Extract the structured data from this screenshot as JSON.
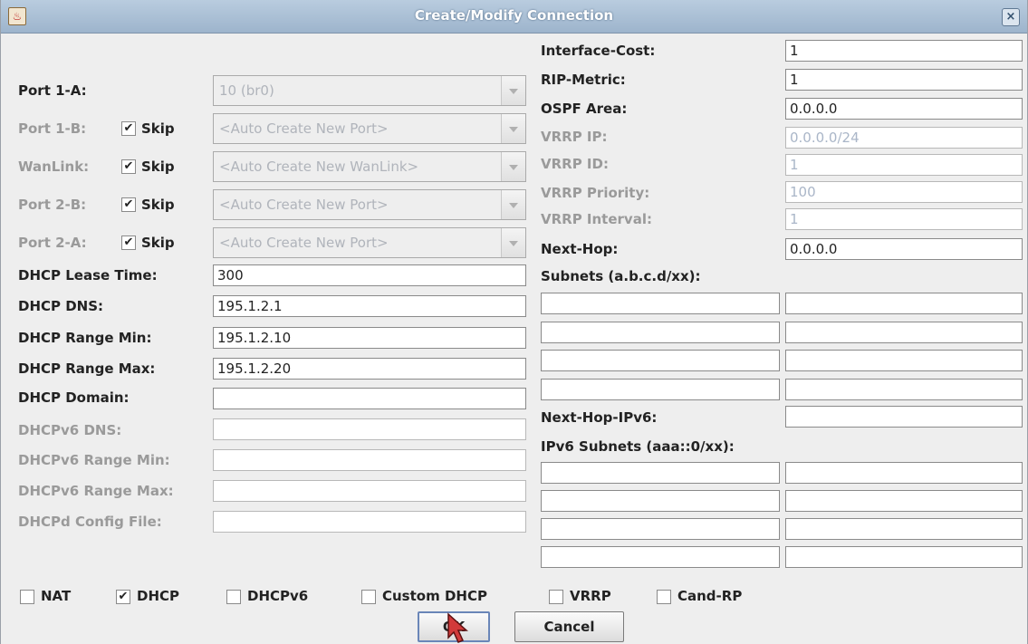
{
  "window": {
    "title": "Create/Modify Connection",
    "close_label": "×",
    "icon_label": "♨"
  },
  "left": {
    "port_1a": {
      "label": "Port 1-A:",
      "value": "10 (br0)"
    },
    "port_1b": {
      "label": "Port 1-B:",
      "skip_label": "Skip",
      "skip_mark": "✔",
      "value": "<Auto Create New Port>"
    },
    "wanlink": {
      "label": "WanLink:",
      "skip_label": "Skip",
      "skip_mark": "✔",
      "value": "<Auto Create New WanLink>"
    },
    "port_2b": {
      "label": "Port 2-B:",
      "skip_label": "Skip",
      "skip_mark": "✔",
      "value": "<Auto Create New Port>"
    },
    "port_2a": {
      "label": "Port 2-A:",
      "skip_label": "Skip",
      "skip_mark": "✔",
      "value": "<Auto Create New Port>"
    },
    "fields": [
      {
        "label": "DHCP Lease Time:",
        "value": "300"
      },
      {
        "label": "DHCP DNS:",
        "value": "195.1.2.1"
      },
      {
        "label": "DHCP Range Min:",
        "value": "195.1.2.10"
      },
      {
        "label": "DHCP Range Max:",
        "value": "195.1.2.20"
      },
      {
        "label": "DHCP Domain:",
        "value": ""
      },
      {
        "label": "DHCPv6 DNS:",
        "value": ""
      },
      {
        "label": "DHCPv6 Range Min:",
        "value": ""
      },
      {
        "label": "DHCPv6 Range Max:",
        "value": ""
      },
      {
        "label": "DHCPd Config File:",
        "value": ""
      }
    ]
  },
  "right": {
    "fields": [
      {
        "label": "Interface-Cost:",
        "value": "1"
      },
      {
        "label": "RIP-Metric:",
        "value": "1"
      },
      {
        "label": "OSPF Area:",
        "value": "0.0.0.0"
      },
      {
        "label": "VRRP IP:",
        "value": "0.0.0.0/24"
      },
      {
        "label": "VRRP ID:",
        "value": "1"
      },
      {
        "label": "VRRP Priority:",
        "value": "100"
      },
      {
        "label": "VRRP Interval:",
        "value": "1"
      },
      {
        "label": "Next-Hop:",
        "value": "0.0.0.0"
      }
    ],
    "subnets_label": "Subnets (a.b.c.d/xx):",
    "next_hop_ipv6_label": "Next-Hop-IPv6:",
    "ipv6_subnets_label": "IPv6 Subnets (aaa::0/xx):"
  },
  "options": [
    {
      "label": "NAT",
      "mark": ""
    },
    {
      "label": "DHCP",
      "mark": "✔"
    },
    {
      "label": "DHCPv6",
      "mark": ""
    },
    {
      "label": "Custom DHCP",
      "mark": ""
    },
    {
      "label": "VRRP",
      "mark": ""
    },
    {
      "label": "Cand-RP",
      "mark": ""
    }
  ],
  "buttons": {
    "ok": "OK",
    "cancel": "Cancel"
  }
}
